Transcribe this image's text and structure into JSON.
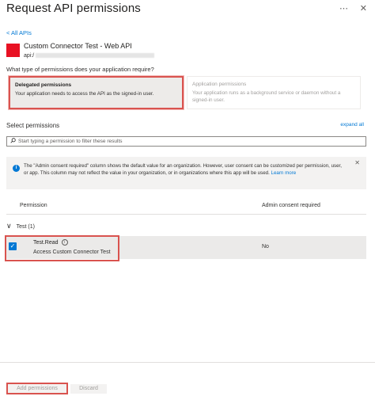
{
  "header": {
    "title": "Request API permissions",
    "more_icon": "ellipsis-icon",
    "close_icon": "close-icon"
  },
  "nav": {
    "back_link": "< All APIs"
  },
  "app": {
    "name": "Custom Connector Test - Web API",
    "uri_prefix": "api:/",
    "logo_color": "#e81123"
  },
  "question": "What type of permissions does your application require?",
  "permission_types": {
    "delegated": {
      "title": "Delegated permissions",
      "description": "Your application needs to access the API as the signed-in user."
    },
    "application": {
      "title": "Application permissions",
      "description": "Your application runs as a background service or daemon without a signed-in user."
    }
  },
  "select_permissions": {
    "label": "Select permissions",
    "expand_all": "expand all",
    "search_placeholder": "Start typing a permission to filter these results"
  },
  "info_banner": {
    "text": "The \"Admin consent required\" column shows the default value for an organization. However, user consent can be customized per permission, user, or app. This column may not reflect the value in your organization, or in organizations where this app will be used.",
    "learn_more": "Learn more"
  },
  "table": {
    "col_permission": "Permission",
    "col_admin": "Admin consent required",
    "group": "Test (1)",
    "rows": [
      {
        "name": "Test.Read",
        "description": "Access Custom Connector Test",
        "admin_consent": "No",
        "checked": true
      }
    ]
  },
  "footer": {
    "add_button": "Add permissions",
    "discard_button": "Discard"
  },
  "colors": {
    "accent": "#0078d4",
    "highlight_border": "#d9534f"
  }
}
